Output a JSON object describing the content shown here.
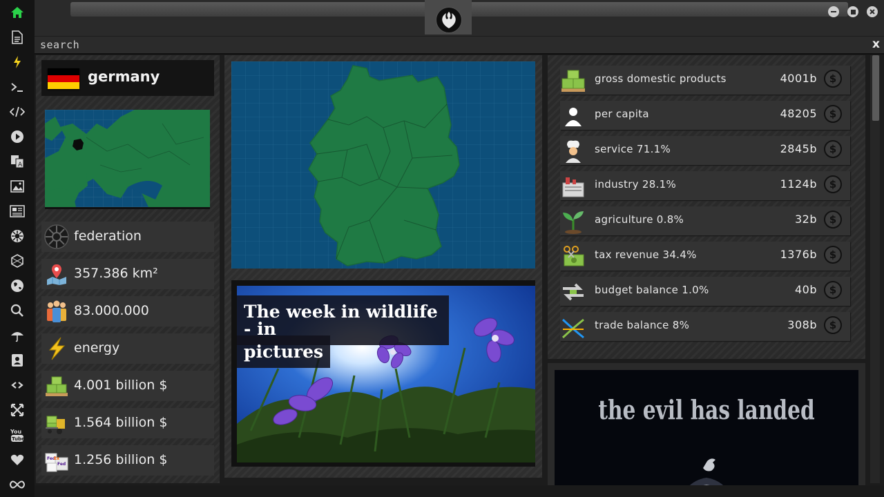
{
  "window": {
    "search_label": "search",
    "close_label": "x"
  },
  "country": {
    "name": "germany",
    "flag_colors": [
      "#000000",
      "#dd0000",
      "#ffce00"
    ]
  },
  "info_rows": [
    {
      "icon": "empire-emblem-icon",
      "text": "federation"
    },
    {
      "icon": "map-pin-icon",
      "text": "357.386 km²"
    },
    {
      "icon": "population-icon",
      "text": "83.000.000"
    },
    {
      "icon": "lightning-icon",
      "text": "energy"
    },
    {
      "icon": "money-pallet-icon",
      "text": "4.001 billion $"
    },
    {
      "icon": "forklift-money-icon",
      "text": "1.564 billion $"
    },
    {
      "icon": "fedex-boxes-icon",
      "text": "1.256 billion $"
    }
  ],
  "news": {
    "headline_line1": "The week in wildlife - in",
    "headline_line2": "pictures"
  },
  "stats": [
    {
      "icon": "money-pallet-icon",
      "label": "gross domestic products",
      "value": "4001b"
    },
    {
      "icon": "person-icon",
      "label": "per capita",
      "value": "48205"
    },
    {
      "icon": "chef-icon",
      "label": "service 71.1%",
      "value": "2845b"
    },
    {
      "icon": "factory-icon",
      "label": "industry 28.1%",
      "value": "1124b"
    },
    {
      "icon": "sprout-icon",
      "label": "agriculture 0.8%",
      "value": "32b"
    },
    {
      "icon": "tax-scissors-icon",
      "label": "tax revenue 34.4%",
      "value": "1376b"
    },
    {
      "icon": "exchange-arrows-icon",
      "label": "budget balance 1.0%",
      "value": "40b"
    },
    {
      "icon": "trade-cross-icon",
      "label": "trade balance 8%",
      "value": "308b"
    }
  ],
  "banner": {
    "text": "the evil has landed"
  },
  "sidebar": [
    "home-icon",
    "document-icon",
    "lightning-icon",
    "terminal-icon",
    "code-icon",
    "play-icon",
    "translate-icon",
    "image-icon",
    "news-icon",
    "settings-icon",
    "hexagon-icon",
    "globe-icon",
    "search-icon",
    "umbrella-icon",
    "contact-icon",
    "link-icon",
    "expand-icon",
    "youtube-icon",
    "heart-icon",
    "infinity-icon"
  ],
  "colors": {
    "accent_green": "#2bd34a",
    "map_land": "#1f7a44",
    "map_sea": "#0d4f7a"
  }
}
